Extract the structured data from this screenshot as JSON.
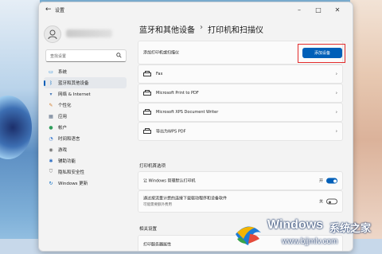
{
  "window": {
    "title": "设置"
  },
  "sidebar": {
    "search_placeholder": "查找设置",
    "items": [
      {
        "label": "系统",
        "icon": "system-icon",
        "color": "#0078d4"
      },
      {
        "label": "蓝牙和其他设备",
        "icon": "bluetooth-icon",
        "color": "#0067c0",
        "active": true
      },
      {
        "label": "网络 & Internet",
        "icon": "network-icon",
        "color": "#4a7ab7"
      },
      {
        "label": "个性化",
        "icon": "personalization-icon",
        "color": "#d07b2a"
      },
      {
        "label": "应用",
        "icon": "apps-icon",
        "color": "#5a6c85"
      },
      {
        "label": "帐户",
        "icon": "account-icon",
        "color": "#2f9e5b"
      },
      {
        "label": "时间和语言",
        "icon": "time-language-icon",
        "color": "#3a7ad1"
      },
      {
        "label": "游戏",
        "icon": "gaming-icon",
        "color": "#6e6e6e"
      },
      {
        "label": "辅助功能",
        "icon": "accessibility-icon",
        "color": "#2f6fc4"
      },
      {
        "label": "隐私和安全性",
        "icon": "privacy-shield-icon",
        "color": "#6e6e6e"
      },
      {
        "label": "Windows 更新",
        "icon": "windows-update-icon",
        "color": "#0067c0"
      }
    ]
  },
  "main": {
    "breadcrumb_parent": "蓝牙和其他设备",
    "breadcrumb_sep": "›",
    "breadcrumb_current": "打印机和扫描仪",
    "add_row_label": "添加打印机或扫描仪",
    "add_button": "添加设备",
    "printers": [
      {
        "label": "Fax"
      },
      {
        "label": "Microsoft Print to PDF"
      },
      {
        "label": "Microsoft XPS Document Writer"
      },
      {
        "label": "导出为WPS PDF"
      }
    ],
    "prefs_header": "打印机首选项",
    "pref_default": {
      "label": "让 Windows 管理默认打印机",
      "state": "开"
    },
    "pref_metered": {
      "label": "通过按流量计费的连接下载驱动程序和设备软件",
      "sub": "可能需要额外费用",
      "state": "关"
    },
    "related_header": "相关设置",
    "related_item": "打印服务器属性"
  },
  "watermark": {
    "brand": "Windows",
    "brand_cn": "系统之家",
    "url": "www.bjjmlv.com"
  }
}
